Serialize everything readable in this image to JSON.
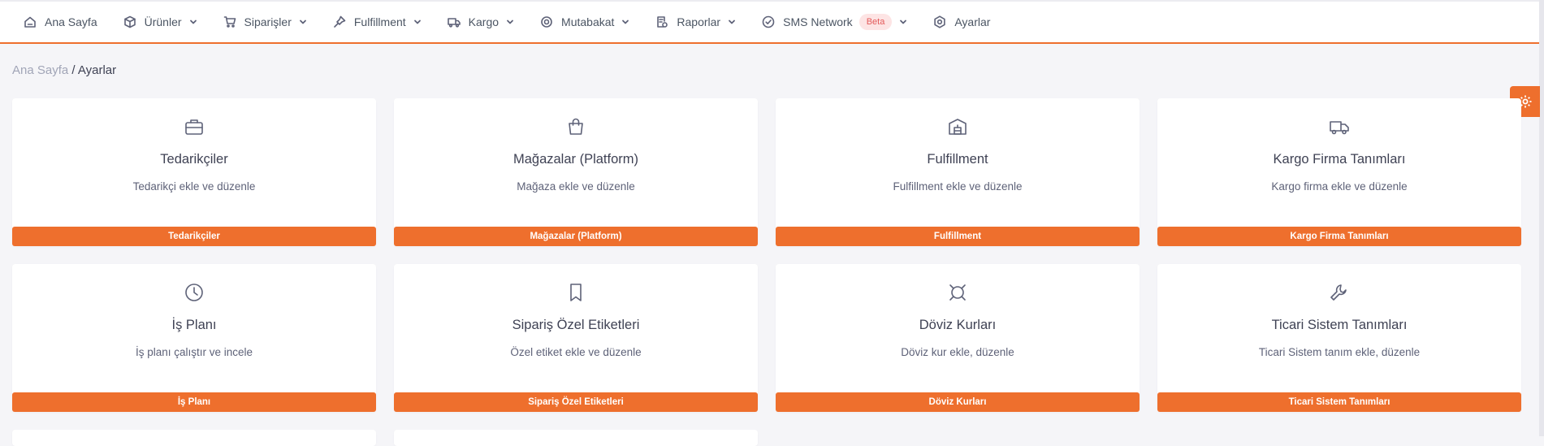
{
  "nav": {
    "items": [
      {
        "label": "Ana Sayfa",
        "icon": "home-icon",
        "has_dropdown": false
      },
      {
        "label": "Ürünler",
        "icon": "box-icon",
        "has_dropdown": true
      },
      {
        "label": "Siparişler",
        "icon": "cart-icon",
        "has_dropdown": true
      },
      {
        "label": "Fulfillment",
        "icon": "pin-icon",
        "has_dropdown": true
      },
      {
        "label": "Kargo",
        "icon": "truck-icon",
        "has_dropdown": true
      },
      {
        "label": "Mutabakat",
        "icon": "target-icon",
        "has_dropdown": true
      },
      {
        "label": "Raporlar",
        "icon": "report-icon",
        "has_dropdown": true
      },
      {
        "label": "SMS Network",
        "icon": "check-circle-icon",
        "has_dropdown": true,
        "badge": "Beta"
      },
      {
        "label": "Ayarlar",
        "icon": "settings-icon",
        "has_dropdown": false
      }
    ]
  },
  "breadcrumb": {
    "home": "Ana Sayfa",
    "separator": " / ",
    "current": "Ayarlar"
  },
  "colors": {
    "accent": "#ee6f2d",
    "background": "#f5f5f8",
    "card": "#ffffff",
    "badge_bg": "#fde4e4",
    "badge_text": "#e35a5a"
  },
  "cards": [
    {
      "icon": "briefcase-icon",
      "title": "Tedarikçiler",
      "desc": "Tedarikçi ekle ve düzenle",
      "button": "Tedarikçiler"
    },
    {
      "icon": "shopping-bag-icon",
      "title": "Mağazalar (Platform)",
      "desc": "Mağaza ekle ve düzenle",
      "button": "Mağazalar (Platform)"
    },
    {
      "icon": "warehouse-icon",
      "title": "Fulfillment",
      "desc": "Fulfillment ekle ve düzenle",
      "button": "Fulfillment"
    },
    {
      "icon": "truck-icon",
      "title": "Kargo Firma Tanımları",
      "desc": "Kargo firma ekle ve düzenle",
      "button": "Kargo Firma Tanımları"
    },
    {
      "icon": "clock-icon",
      "title": "İş Planı",
      "desc": "İş planı çalıştır ve incele",
      "button": "İş Planı"
    },
    {
      "icon": "bookmark-icon",
      "title": "Sipariş Özel Etiketleri",
      "desc": "Özel etiket ekle ve düzenle",
      "button": "Sipariş Özel Etiketleri"
    },
    {
      "icon": "currency-icon",
      "title": "Döviz Kurları",
      "desc": "Döviz kur ekle, düzenle",
      "button": "Döviz Kurları"
    },
    {
      "icon": "wrench-icon",
      "title": "Ticari Sistem Tanımları",
      "desc": "Ticari Sistem tanım ekle, düzenle",
      "button": "Ticari Sistem Tanımları"
    }
  ]
}
